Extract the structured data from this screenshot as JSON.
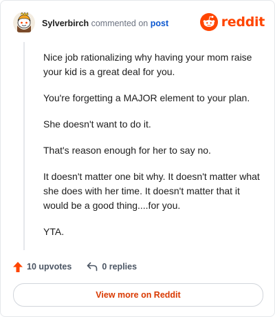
{
  "comment": {
    "author": "Sylverbirch",
    "action": "commented on",
    "target": "post",
    "body": [
      "Nice job rationalizing why having your mom raise your kid is a great deal for you.",
      "You're forgetting a MAJOR element to your plan.",
      "She doesn't want to do it.",
      "That's reason enough for her to say no.",
      "It doesn't matter one bit why. It doesn't matter what she does with her time. It doesn't matter that it would be a good thing....for you.",
      "YTA."
    ],
    "upvotes": "10 upvotes",
    "replies": "0 replies"
  },
  "brand": {
    "name": "reddit",
    "color": "#ff4500"
  },
  "cta": {
    "label": "View more on Reddit"
  },
  "icons": {
    "avatar": "snoo-avatar",
    "logo": "reddit-logo-icon",
    "upvote": "upvote-arrow-icon",
    "reply": "reply-arrow-icon"
  },
  "colors": {
    "upvote": "#ff4500",
    "link": "#0b57d0",
    "cta_text": "#d93900"
  }
}
